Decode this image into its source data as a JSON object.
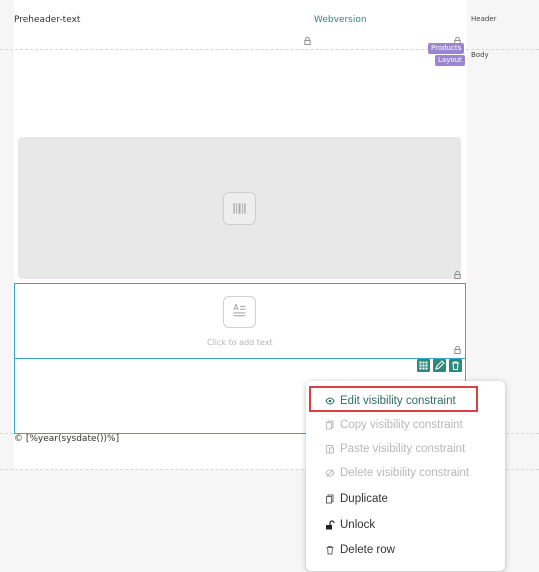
{
  "header": {
    "preheader_text": "Preheader-text",
    "webversion_link": "Webversion",
    "zone_header": "Header",
    "zone_body": "Body"
  },
  "tags": {
    "products": "Products",
    "layout": "Layout"
  },
  "body": {
    "image_icon": "barcode-icon",
    "text_icon": "text-block-icon",
    "text_placeholder": "Click to add text",
    "footer_text": "© [%year(sysdate())%]"
  },
  "row_actions": [
    {
      "icon": "grid-icon"
    },
    {
      "icon": "pencil-icon"
    },
    {
      "icon": "trash-icon"
    }
  ],
  "context_menu": {
    "items": [
      {
        "label": "Edit visibility constraint",
        "icon": "eye-icon",
        "enabled": true
      },
      {
        "label": "Copy visibility constraint",
        "icon": "copy-icon",
        "enabled": false
      },
      {
        "label": "Paste visibility constraint",
        "icon": "paste-icon",
        "enabled": false
      },
      {
        "label": "Delete visibility constraint",
        "icon": "eye-slash-icon",
        "enabled": false
      },
      {
        "label": "Duplicate",
        "icon": "duplicate-icon",
        "enabled": true
      },
      {
        "label": "Unlock",
        "icon": "unlock-icon",
        "enabled": true
      },
      {
        "label": "Delete row",
        "icon": "trash-icon",
        "enabled": true
      }
    ]
  },
  "colors": {
    "accent": "#2e8a7a",
    "selection": "#3aa5c9",
    "tag": "#9a86d0",
    "highlight": "#d9403f"
  }
}
